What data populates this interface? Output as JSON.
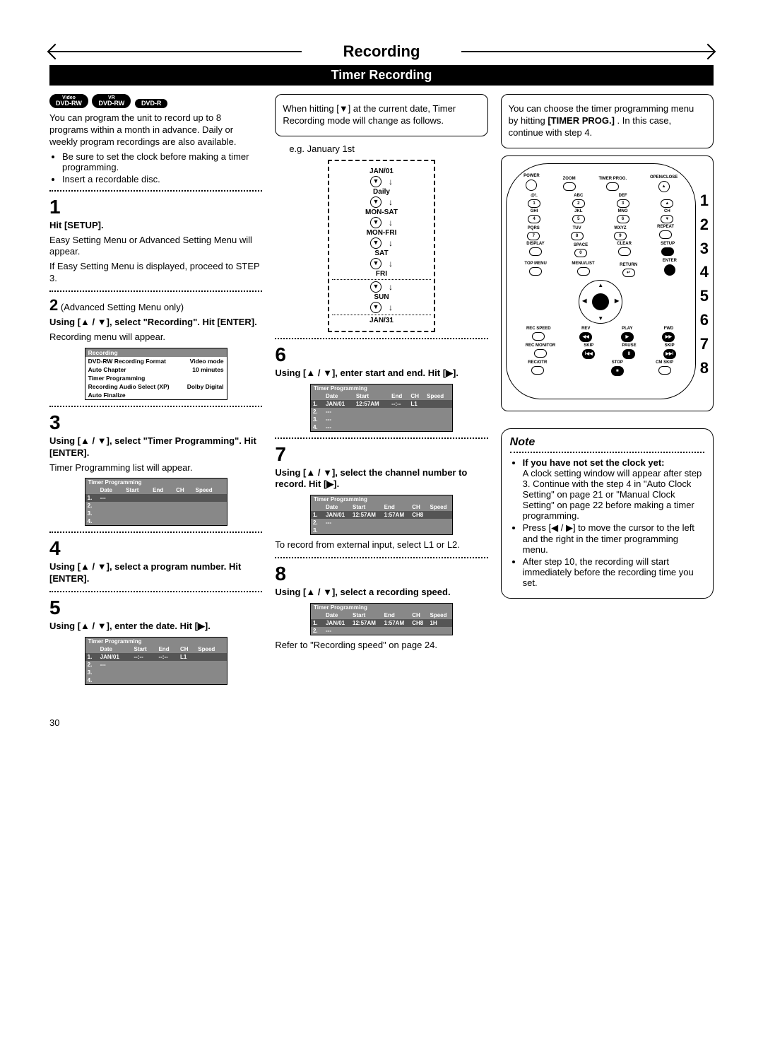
{
  "header": {
    "title": "Recording",
    "subtitle": "Timer Recording"
  },
  "badges": [
    "DVD-RW Video",
    "DVD-RW VR",
    "DVD-R"
  ],
  "intro": {
    "p1": "You can program the unit to record up to 8 programs within a month in advance. Daily or weekly program recordings are also available.",
    "b1": "Be sure to set the clock before making a timer programming.",
    "b2": "Insert a recordable disc."
  },
  "steps": {
    "s1": {
      "num": "1",
      "head": "Hit [SETUP].",
      "body1": "Easy Setting Menu or Advanced Setting Menu will appear.",
      "body2": "If Easy Setting Menu is displayed, proceed to STEP 3."
    },
    "s2": {
      "num": "2",
      "pre": "(Advanced Setting Menu only)",
      "head": "Using [▲ / ▼], select \"Recording\". Hit [ENTER].",
      "body": "Recording menu will appear."
    },
    "recording_menu": {
      "title": "Recording",
      "rows": [
        [
          "DVD-RW Recording Format",
          "Video mode"
        ],
        [
          "Auto Chapter",
          "10 minutes"
        ],
        [
          "Timer Programming",
          ""
        ],
        [
          "Recording Audio Select (XP)",
          "Dolby Digital"
        ],
        [
          "Auto Finalize",
          ""
        ]
      ]
    },
    "s3": {
      "num": "3",
      "head": "Using [▲ / ▼], select \"Timer Programming\". Hit [ENTER].",
      "body": "Timer Programming list will appear."
    },
    "tp_empty": {
      "title": "Timer Programming",
      "cols": [
        "",
        "Date",
        "Start",
        "End",
        "CH",
        "Speed"
      ],
      "rows": [
        [
          "1.",
          "---",
          "",
          "",
          "",
          ""
        ],
        [
          "2.",
          "",
          "",
          "",
          "",
          ""
        ],
        [
          "3.",
          "",
          "",
          "",
          "",
          ""
        ],
        [
          "4.",
          "",
          "",
          "",
          "",
          ""
        ]
      ]
    },
    "s4": {
      "num": "4",
      "head": "Using [▲ / ▼], select a program number. Hit [ENTER]."
    },
    "s5": {
      "num": "5",
      "head": "Using [▲ / ▼], enter the date. Hit [▶]."
    },
    "tp_date": {
      "title": "Timer Programming",
      "cols": [
        "",
        "Date",
        "Start",
        "End",
        "CH",
        "Speed"
      ],
      "rows": [
        [
          "1.",
          "JAN/01",
          "--:--",
          "--:--",
          "L1",
          ""
        ],
        [
          "2.",
          "---",
          "",
          "",
          "",
          ""
        ],
        [
          "3.",
          "",
          "",
          "",
          "",
          ""
        ],
        [
          "4.",
          "",
          "",
          "",
          "",
          ""
        ]
      ]
    }
  },
  "col2": {
    "callout": "When hitting [▼] at the current date, Timer Recording mode will change as follows.",
    "eg": "e.g. January 1st",
    "cycle": [
      "JAN/01",
      "Daily",
      "MON-SAT",
      "MON-FRI",
      "SAT",
      "FRI",
      "SUN",
      "JAN/31"
    ],
    "s6": {
      "num": "6",
      "head": "Using [▲ / ▼], enter start and end. Hit [▶]."
    },
    "tp6": {
      "title": "Timer Programming",
      "cols": [
        "",
        "Date",
        "Start",
        "End",
        "CH",
        "Speed"
      ],
      "rows": [
        [
          "1.",
          "JAN/01",
          "12:57AM",
          "--:--",
          "L1",
          ""
        ],
        [
          "2.",
          "---",
          "",
          "",
          "",
          ""
        ],
        [
          "3.",
          "---",
          "",
          "",
          "",
          ""
        ],
        [
          "4.",
          "---",
          "",
          "",
          "",
          ""
        ]
      ]
    },
    "s7": {
      "num": "7",
      "head": "Using [▲ / ▼], select the channel number to record. Hit [▶]."
    },
    "tp7": {
      "title": "Timer Programming",
      "cols": [
        "",
        "Date",
        "Start",
        "End",
        "CH",
        "Speed"
      ],
      "rows": [
        [
          "1.",
          "JAN/01",
          "12:57AM",
          "1:57AM",
          "CH8",
          ""
        ],
        [
          "2.",
          "---",
          "",
          "",
          "",
          ""
        ],
        [
          "3.",
          "",
          "",
          "",
          "",
          ""
        ]
      ]
    },
    "after7": "To record from external input, select L1 or L2.",
    "s8": {
      "num": "8",
      "head": "Using [▲ / ▼], select a recording speed."
    },
    "tp8": {
      "title": "Timer Programming",
      "cols": [
        "",
        "Date",
        "Start",
        "End",
        "CH",
        "Speed"
      ],
      "rows": [
        [
          "1.",
          "JAN/01",
          "12:57AM",
          "1:57AM",
          "CH8",
          "1H"
        ],
        [
          "2.",
          "---",
          "",
          "",
          "",
          ""
        ]
      ]
    },
    "after8": "Refer to \"Recording speed\" on page 24."
  },
  "col3": {
    "callout_a": "You can choose the timer programming menu by hitting ",
    "callout_b": "[TIMER PROG.]",
    "callout_c": " . In this case, continue with step 4.",
    "remote": {
      "row1": [
        "POWER",
        "",
        "TIMER PROG.",
        "OPEN/CLOSE"
      ],
      "row_zoom": "ZOOM",
      "numpad_top": [
        "@!.",
        "ABC",
        "DEF",
        ""
      ],
      "numpad": [
        [
          "1",
          "2",
          "3",
          "▲"
        ],
        [
          "4",
          "5",
          "6",
          "▼"
        ],
        [
          "7",
          "8",
          "9",
          ""
        ],
        [
          "",
          "0",
          "",
          ""
        ]
      ],
      "numpad_lbl2": [
        "GHI",
        "JKL",
        "MNO",
        "CH"
      ],
      "numpad_lbl3": [
        "PQRS",
        "TUV",
        "WXYZ",
        "REPEAT"
      ],
      "toprow": [
        "DISPLAY",
        "SPACE",
        "CLEAR",
        "SETUP"
      ],
      "menurow": [
        "TOP MENU",
        "MENU/LIST",
        "RETURN",
        "ENTER"
      ],
      "transport1": [
        "REC SPEED",
        "REV",
        "PLAY",
        "FWD"
      ],
      "transport2": [
        "REC MONITOR",
        "SKIP",
        "PAUSE",
        "SKIP"
      ],
      "transport3": [
        "REC/OTR",
        "",
        "STOP",
        "CM SKIP"
      ]
    },
    "side_nums": [
      "1",
      "2",
      "3",
      "4",
      "5",
      "6",
      "7",
      "8"
    ],
    "note": {
      "title": "Note",
      "h1": "If you have not set the clock yet:",
      "n1": "A clock setting window will appear after step 3. Continue with the step 4 in \"Auto Clock Setting\" on page 21 or \"Manual Clock Setting\" on page 22 before making a timer programming.",
      "n2": "Press [◀ / ▶] to move the cursor to the left and the right in the timer programming menu.",
      "n3": "After step 10, the recording will start immediately before the recording time you set."
    }
  },
  "page_number": "30"
}
